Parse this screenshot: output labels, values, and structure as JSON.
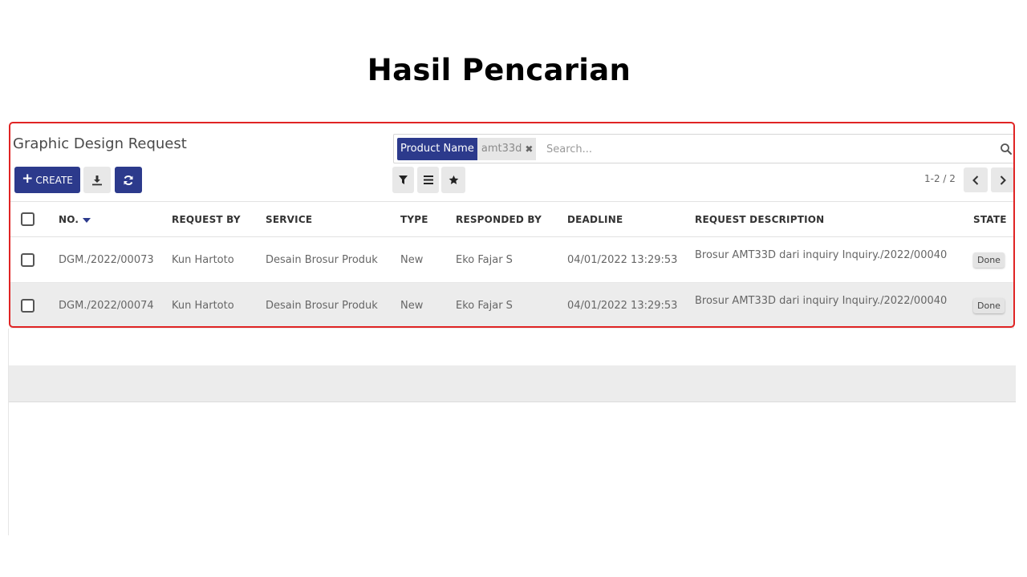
{
  "slide": {
    "title": "Hasil Pencarian"
  },
  "app": {
    "title": "Graphic Design Request",
    "search": {
      "facet_label": "Product Name",
      "facet_value": "amt33d",
      "placeholder": "Search..."
    },
    "toolbar": {
      "create_label": "CREATE"
    },
    "pager": {
      "value": "1-2 / 2"
    },
    "table": {
      "columns": [
        "NO.",
        "REQUEST BY",
        "SERVICE",
        "TYPE",
        "RESPONDED BY",
        "DEADLINE",
        "REQUEST DESCRIPTION",
        "STATE"
      ],
      "rows": [
        {
          "no": "DGM./2022/00073",
          "request_by": "Kun Hartoto",
          "service": "Desain Brosur Produk",
          "type": "New",
          "responded_by": "Eko Fajar S",
          "deadline": "04/01/2022 13:29:53",
          "description": "Brosur AMT33D dari inquiry Inquiry./2022/00040",
          "state": "Done"
        },
        {
          "no": "DGM./2022/00074",
          "request_by": "Kun Hartoto",
          "service": "Desain Brosur Produk",
          "type": "New",
          "responded_by": "Eko Fajar S",
          "deadline": "04/01/2022 13:29:53",
          "description": "Brosur AMT33D dari inquiry Inquiry./2022/00040",
          "state": "Done"
        }
      ]
    }
  },
  "colors": {
    "primary": "#2c3a8c",
    "highlight": "#e02424",
    "row_alt": "#ececec"
  },
  "icons": [
    "download-icon",
    "refresh-icon",
    "filter-icon",
    "list-icon",
    "star-icon",
    "search-icon",
    "chevron-left-icon",
    "chevron-right-icon",
    "close-icon",
    "sort-caret-icon"
  ]
}
